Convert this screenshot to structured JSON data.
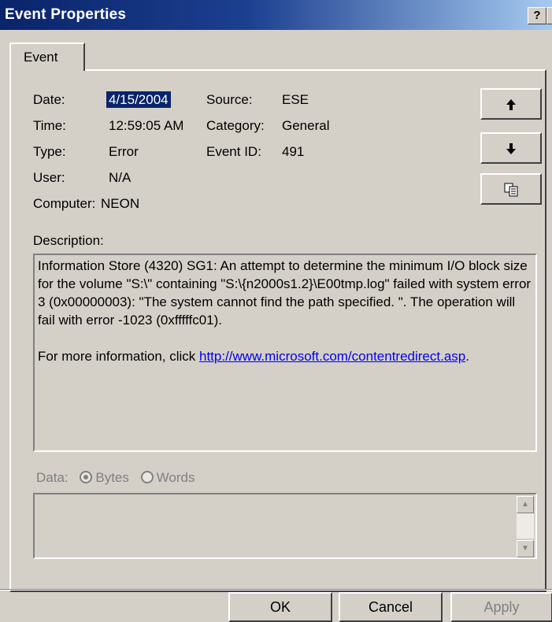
{
  "window": {
    "title": "Event Properties",
    "help_label": "?",
    "close_label": "×"
  },
  "tabs": [
    {
      "label": "Event"
    }
  ],
  "fields": {
    "date": {
      "label": "Date:",
      "value": "4/15/2004"
    },
    "time": {
      "label": "Time:",
      "value": "12:59:05 AM"
    },
    "type": {
      "label": "Type:",
      "value": "Error"
    },
    "user": {
      "label": "User:",
      "value": "N/A"
    },
    "computer": {
      "label": "Computer:",
      "value": "NEON"
    },
    "source": {
      "label": "Source:",
      "value": "ESE"
    },
    "category": {
      "label": "Category:",
      "value": "General"
    },
    "event_id": {
      "label": "Event ID:",
      "value": "491"
    }
  },
  "nav_buttons": {
    "up": "🡅",
    "down": "🡇",
    "copy_icon": "copy-icon"
  },
  "description": {
    "label": "Description:",
    "text": "Information Store (4320) SG1: An attempt to determine the minimum I/O block size for the volume \"S:\\\" containing \"S:\\{n2000s1.2}\\E00tmp.log\" failed with system error 3 (0x00000003): \"The system cannot find the path specified. \". The operation will fail with error -1023 (0xfffffc01).",
    "more_info_prefix": "For more information, click ",
    "link": "http://www.microsoft.com/contentredirect.asp",
    "link_suffix": "."
  },
  "data_section": {
    "label": "Data:",
    "options": [
      {
        "label": "Bytes",
        "selected": true
      },
      {
        "label": "Words",
        "selected": false
      }
    ]
  },
  "buttons": {
    "ok": "OK",
    "cancel": "Cancel",
    "apply": "Apply"
  },
  "colors": {
    "title_bar": "#0a246a",
    "face": "#d4d0c8",
    "selection": "#0a246a",
    "link": "#0000ee",
    "disabled": "#808080"
  }
}
